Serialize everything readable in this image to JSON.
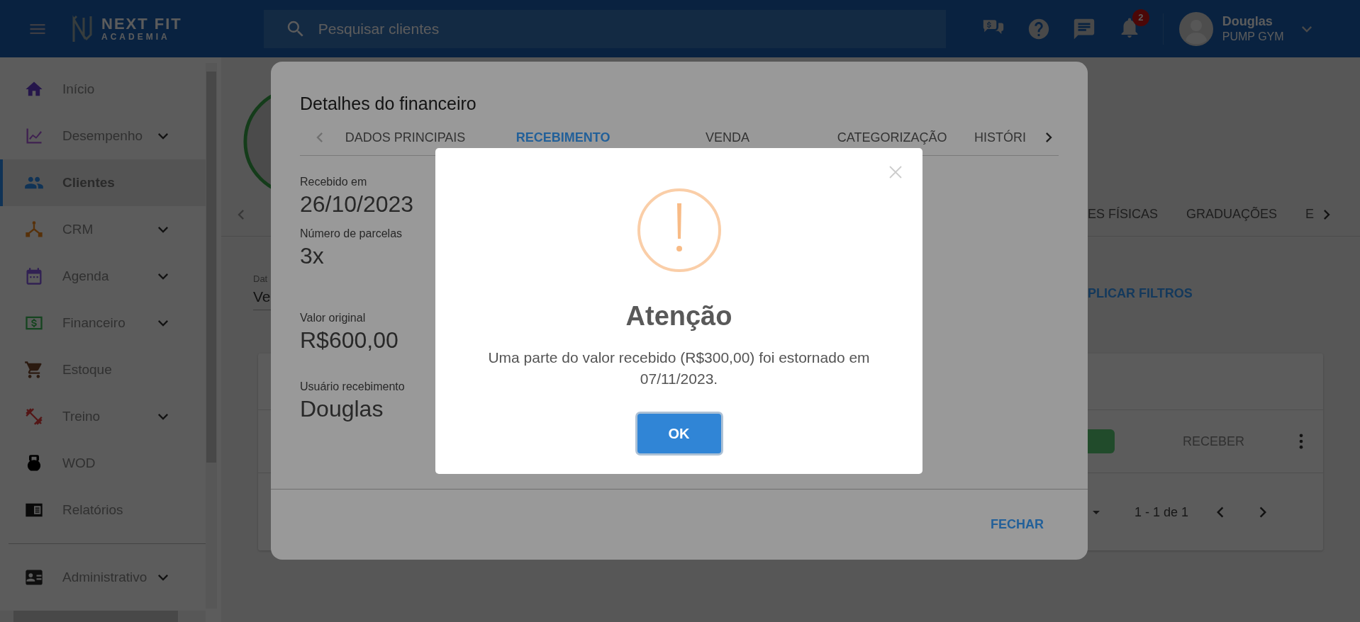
{
  "header": {
    "logo": {
      "name": "NEXT FIT",
      "subtitle": "ACADEMIA"
    },
    "search": {
      "placeholder": "Pesquisar clientes"
    },
    "notification_count": "2",
    "user": {
      "name": "Douglas",
      "company": "PUMP GYM"
    }
  },
  "sidebar": {
    "items": [
      {
        "label": "Início",
        "expandable": false,
        "selected": false
      },
      {
        "label": "Desempenho",
        "expandable": true,
        "selected": false
      },
      {
        "label": "Clientes",
        "expandable": false,
        "selected": true
      },
      {
        "label": "CRM",
        "expandable": true,
        "selected": false
      },
      {
        "label": "Agenda",
        "expandable": true,
        "selected": false
      },
      {
        "label": "Financeiro",
        "expandable": true,
        "selected": false
      },
      {
        "label": "Estoque",
        "expandable": false,
        "selected": false
      },
      {
        "label": "Treino",
        "expandable": true,
        "selected": false
      },
      {
        "label": "WOD",
        "expandable": false,
        "selected": false
      },
      {
        "label": "Relatórios",
        "expandable": false,
        "selected": false
      }
    ],
    "bottom_items": [
      {
        "label": "Administrativo",
        "expandable": true,
        "selected": false
      }
    ]
  },
  "background": {
    "tabs": [
      "ES FÍSICAS",
      "GRADUAÇÕES",
      "E"
    ],
    "filter": {
      "label": "Dat",
      "value": "Ve"
    },
    "apply_button": "PLICAR FILTROS",
    "row_action": "RECEBER",
    "pagination": "1 - 1 de 1"
  },
  "modal": {
    "title": "Detalhes do financeiro",
    "tabs": [
      {
        "label": "DADOS PRINCIPAIS",
        "selected": false
      },
      {
        "label": "RECEBIMENTO",
        "selected": true
      },
      {
        "label": "VENDA",
        "selected": false
      },
      {
        "label": "CATEGORIZAÇÃO",
        "selected": false
      },
      {
        "label": "HISTÓRI",
        "selected": false
      }
    ],
    "fields": [
      {
        "label": "Recebido em",
        "value": "26/10/2023"
      },
      {
        "label": "Número de parcelas",
        "value": "3x"
      },
      {
        "label": "Valor original",
        "value": "R$600,00"
      },
      {
        "label": "Usuário recebimento",
        "value": "Douglas"
      }
    ],
    "close_button": "FECHAR"
  },
  "alert": {
    "title": "Atenção",
    "message": "Uma parte do valor recebido (R$300,00) foi estornado em 07/11/2023.",
    "button": "OK"
  }
}
